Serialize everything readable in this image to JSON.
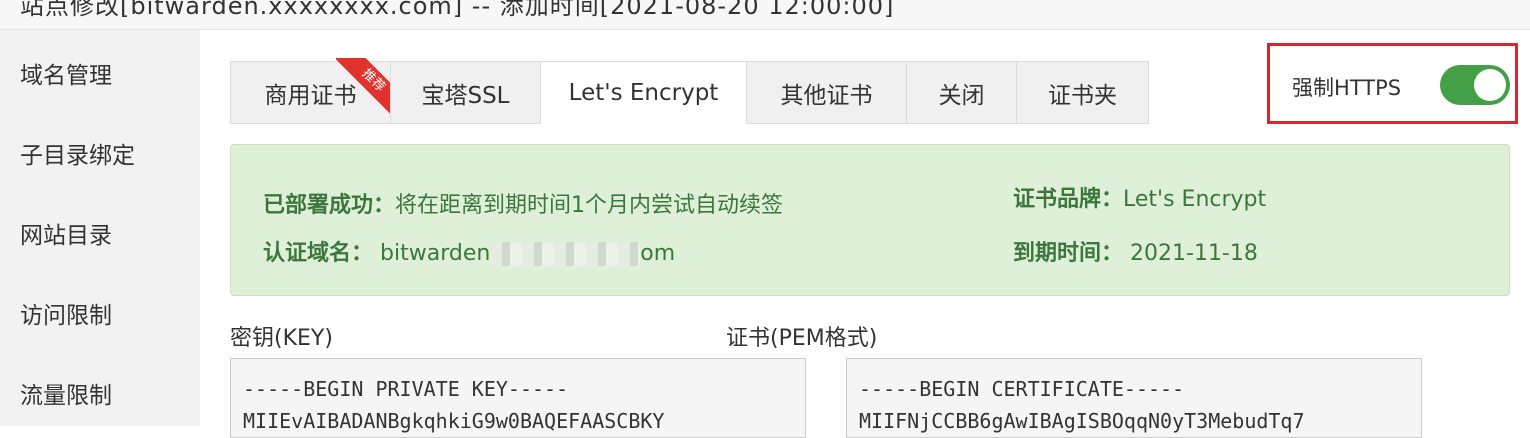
{
  "topbar": {
    "title": "站点修改[bitwarden.xxxxxxxx.com] -- 添加时间[2021-08-20 12:00:00]"
  },
  "sidebar": {
    "items": [
      {
        "label": "域名管理"
      },
      {
        "label": "子目录绑定"
      },
      {
        "label": "网站目录"
      },
      {
        "label": "访问限制"
      },
      {
        "label": "流量限制"
      }
    ]
  },
  "tabs": [
    {
      "label": "商用证书",
      "ribbon": "推荐"
    },
    {
      "label": "宝塔SSL"
    },
    {
      "label": "Let's Encrypt"
    },
    {
      "label": "其他证书"
    },
    {
      "label": "关闭"
    },
    {
      "label": "证书夹"
    }
  ],
  "https": {
    "label": "强制HTTPS",
    "enabled": true
  },
  "status": {
    "deploy_label": "已部署成功：",
    "deploy_text": "将在距离到期时间1个月内尝试自动续签",
    "domain_label": "认证域名：",
    "domain_prefix": "bitwarden",
    "domain_suffix": "om",
    "brand_label": "证书品牌：",
    "brand_value": "Let's Encrypt",
    "expire_label": "到期时间：",
    "expire_value": "2021-11-18"
  },
  "key": {
    "label": "密钥(KEY)",
    "line1": "-----BEGIN PRIVATE KEY-----",
    "line2": "MIIEvAIBADANBgkqhkiG9w0BAQEFAASCBKY"
  },
  "cert": {
    "label": "证书(PEM格式)",
    "line1": "-----BEGIN CERTIFICATE-----",
    "line2": "MIIFNjCCBB6gAwIBAgISBOqqN0yT3MebudTq7"
  },
  "colors": {
    "accent_green": "#43a047",
    "alert_bg": "#dff0d8",
    "alert_text": "#3c763d",
    "highlight_red": "#d9272e"
  }
}
